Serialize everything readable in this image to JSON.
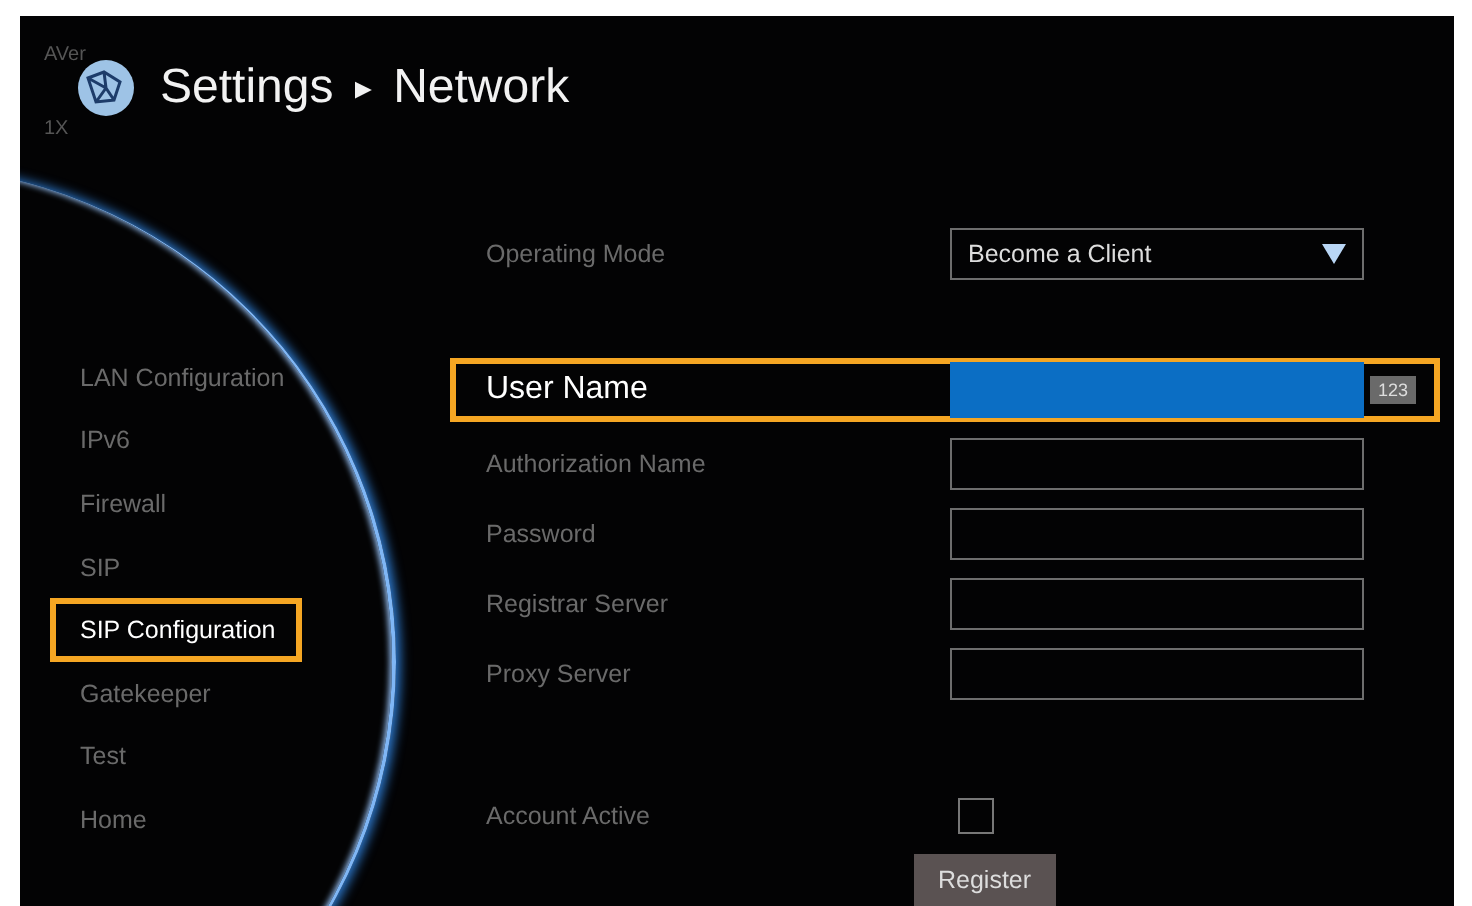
{
  "header": {
    "logo_top": "AVer",
    "logo_bottom": "1X",
    "title": "Settings",
    "separator": "►",
    "subtitle": "Network"
  },
  "sidebar": {
    "items": [
      {
        "label": "LAN Configuration",
        "selected": false
      },
      {
        "label": "IPv6",
        "selected": false
      },
      {
        "label": "Firewall",
        "selected": false
      },
      {
        "label": "SIP",
        "selected": false
      },
      {
        "label": "SIP Configuration",
        "selected": true
      },
      {
        "label": "Gatekeeper",
        "selected": false
      },
      {
        "label": "Test",
        "selected": false
      },
      {
        "label": "Home",
        "selected": false
      }
    ]
  },
  "form": {
    "rows": [
      {
        "kind": "dropdown",
        "label": "Operating Mode",
        "value": "Become a Client",
        "focused": false
      },
      {
        "kind": "text",
        "label": "User Name",
        "focused": true,
        "input_mode": "123"
      },
      {
        "kind": "text",
        "label": "Authorization Name",
        "focused": false
      },
      {
        "kind": "text",
        "label": "Password",
        "focused": false
      },
      {
        "kind": "text",
        "label": "Registrar Server",
        "focused": false
      },
      {
        "kind": "text",
        "label": "Proxy Server",
        "focused": false
      },
      {
        "kind": "checkbox",
        "label": "Account Active",
        "checked": false,
        "focused": false
      },
      {
        "kind": "button",
        "label": "Register",
        "focused": false
      }
    ]
  }
}
